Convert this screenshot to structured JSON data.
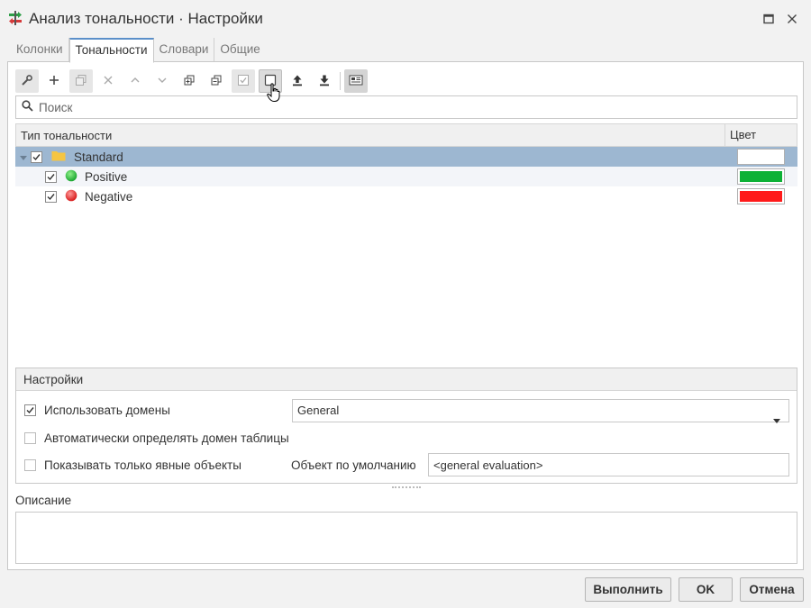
{
  "window": {
    "title": "Анализ тональности · Настройки",
    "maximize_icon": "maximize-icon",
    "close_icon": "close-icon"
  },
  "tabs": [
    {
      "label": "Колонки",
      "active": false
    },
    {
      "label": "Тональности",
      "active": true
    },
    {
      "label": "Словари",
      "active": false
    },
    {
      "label": "Общие",
      "active": false
    }
  ],
  "toolbar": {
    "buttons": [
      "wrench-icon",
      "plus-icon",
      "duplicate-icon",
      "delete-icon",
      "move-up-icon",
      "move-down-icon",
      "expand-all-icon",
      "collapse-all-icon",
      "check-all-icon",
      "uncheck-all-icon",
      "import-icon",
      "export-icon",
      "view-mode-icon"
    ]
  },
  "search": {
    "placeholder": "Поиск"
  },
  "grid": {
    "columns": {
      "type": "Тип тональности",
      "color": "Цвет"
    },
    "rows": [
      {
        "label": "Standard",
        "checked": true,
        "level": 0,
        "icon": "folder-icon",
        "color": "#ffffff",
        "selected": true
      },
      {
        "label": "Positive",
        "checked": true,
        "level": 1,
        "icon": "green-circle-icon",
        "color": "#0db136",
        "selected": false
      },
      {
        "label": "Negative",
        "checked": true,
        "level": 1,
        "icon": "red-circle-icon",
        "color": "#ff1a1a",
        "selected": false
      }
    ]
  },
  "settings": {
    "header": "Настройки",
    "use_domains": {
      "label": "Использовать домены",
      "checked": true
    },
    "auto_detect": {
      "label": "Автоматически определять домен таблицы",
      "checked": false
    },
    "explicit_only": {
      "label": "Показывать только явные объекты",
      "checked": false
    },
    "domain_select": {
      "value": "General"
    },
    "default_object": {
      "label": "Объект по умолчанию",
      "value": "<general evaluation>"
    }
  },
  "description": {
    "label": "Описание",
    "value": ""
  },
  "buttons": {
    "run": "Выполнить",
    "ok": "OK",
    "cancel": "Отмена"
  },
  "colors": {
    "selection": "#9db7d1",
    "tab_accent": "#5b8fc9"
  }
}
